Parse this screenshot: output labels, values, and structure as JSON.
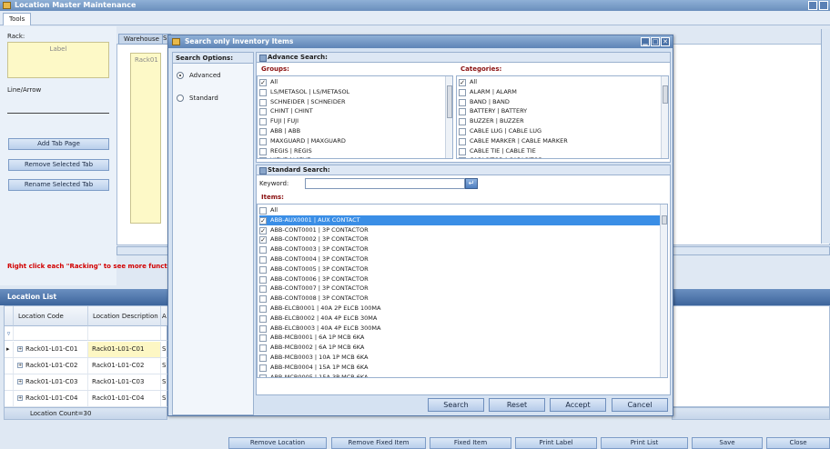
{
  "app": {
    "title": "Location Master Maintenance",
    "ribbon_tab": "Tools"
  },
  "left_panel": {
    "rack_label": "Rack:",
    "rack_placeholder": "Label",
    "line_label": "Line/Arrow",
    "buttons": [
      "Add Tab Page",
      "Remove Selected Tab",
      "Rename Selected Tab"
    ]
  },
  "tabs": {
    "warehouse": "Warehouse",
    "second": "S"
  },
  "canvas": {
    "rack_box": "Rack01"
  },
  "hint": "Right click each \"Racking\" to see more functio",
  "location_list": {
    "title": "Location List",
    "columns": [
      "Location Code",
      "Location Description",
      "A"
    ],
    "rows": [
      {
        "code": "Rack01-L01-C01",
        "desc": "Rack01-L01-C01",
        "a": "S",
        "selected": true
      },
      {
        "code": "Rack01-L01-C02",
        "desc": "Rack01-L01-C02",
        "a": "S"
      },
      {
        "code": "Rack01-L01-C03",
        "desc": "Rack01-L01-C03",
        "a": "S"
      },
      {
        "code": "Rack01-L01-C04",
        "desc": "Rack01-L01-C04",
        "a": "S"
      }
    ],
    "count": "Location Count=30"
  },
  "bottom_buttons": [
    "Remove Location",
    "Remove Fixed Item",
    "Fixed Item",
    "Print Label",
    "Print List",
    "Save",
    "Close"
  ],
  "dialog": {
    "title": "Search only Inventory Items",
    "search_options": {
      "title": "Search Options:",
      "advanced": "Advanced",
      "standard": "Standard",
      "selected": "Advanced"
    },
    "advance_search": {
      "title": "Advance Search:",
      "groups_label": "Groups:",
      "groups": [
        {
          "text": "All",
          "checked": true
        },
        {
          "text": "LS/METASOL  |  LS/METASOL",
          "checked": false
        },
        {
          "text": "SCHNEIDER  |  SCHNEIDER",
          "checked": false
        },
        {
          "text": "CHINT  |  CHINT",
          "checked": false
        },
        {
          "text": "FUJI  |  FUJI",
          "checked": false
        },
        {
          "text": "ABB  |  ABB",
          "checked": false
        },
        {
          "text": "MAXGUARD  |  MAXGUARD",
          "checked": false
        },
        {
          "text": "REGIS  |  REGIS",
          "checked": false
        },
        {
          "text": "VIEVE  |  VIEVE",
          "checked": false
        }
      ],
      "categories_label": "Categories:",
      "categories": [
        {
          "text": "All",
          "checked": true
        },
        {
          "text": "ALARM  |  ALARM",
          "checked": false
        },
        {
          "text": "BAND  |  BAND",
          "checked": false
        },
        {
          "text": "BATTERY  |  BATTERY",
          "checked": false
        },
        {
          "text": "BUZZER  |  BUZZER",
          "checked": false
        },
        {
          "text": "CABLE LUG  |  CABLE LUG",
          "checked": false
        },
        {
          "text": "CABLE MARKER  |  CABLE MARKER",
          "checked": false
        },
        {
          "text": "CABLE TIE  |  CABLE TIE",
          "checked": false
        },
        {
          "text": "CAPACITOR  |  CAPACITOR",
          "checked": false
        }
      ]
    },
    "standard_search": {
      "title": "Standard Search:",
      "keyword_label": "Keyword:",
      "keyword_value": "",
      "items_label": "Items:",
      "items": [
        {
          "text": "All",
          "checked": false
        },
        {
          "text": "ABB-AUX0001  |  AUX CONTACT",
          "checked": true,
          "selected": true
        },
        {
          "text": "ABB-CONT0001  |  3P CONTACTOR",
          "checked": true
        },
        {
          "text": "ABB-CONT0002  |  3P CONTACTOR",
          "checked": true
        },
        {
          "text": "ABB-CONT0003  |  3P CONTACTOR",
          "checked": false
        },
        {
          "text": "ABB-CONT0004  |  3P CONTACTOR",
          "checked": false
        },
        {
          "text": "ABB-CONT0005  |  3P CONTACTOR",
          "checked": false
        },
        {
          "text": "ABB-CONT0006  |  3P CONTACTOR",
          "checked": false
        },
        {
          "text": "ABB-CONT0007  |  3P CONTACTOR",
          "checked": false
        },
        {
          "text": "ABB-CONT0008  |  3P CONTACTOR",
          "checked": false
        },
        {
          "text": "ABB-ELCB0001  |  40A 2P ELCB 100MA",
          "checked": false
        },
        {
          "text": "ABB-ELCB0002  |  40A 4P ELCB 30MA",
          "checked": false
        },
        {
          "text": "ABB-ELCB0003  |  40A 4P ELCB 300MA",
          "checked": false
        },
        {
          "text": "ABB-MCB0001  |  6A 1P MCB 6KA",
          "checked": false
        },
        {
          "text": "ABB-MCB0002  |  6A 1P MCB 6KA",
          "checked": false
        },
        {
          "text": "ABB-MCB0003  |  10A 1P MCB 6KA",
          "checked": false
        },
        {
          "text": "ABB-MCB0004  |  15A 1P MCB 6KA",
          "checked": false
        },
        {
          "text": "ABB-MCB0005  |  15A 3P MCB 6KA",
          "checked": false
        }
      ]
    },
    "buttons": [
      "Search",
      "Reset",
      "Accept",
      "Cancel"
    ]
  }
}
